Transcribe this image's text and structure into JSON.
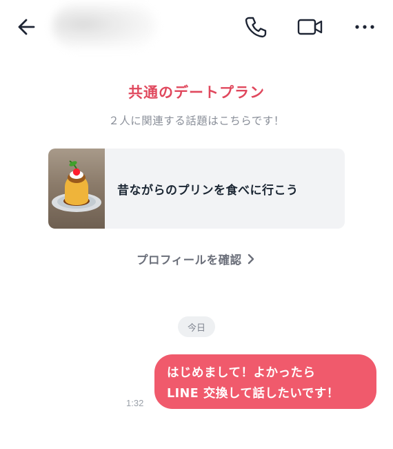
{
  "header": {
    "back_icon": "arrow-left-icon",
    "call_icon": "phone-icon",
    "video_icon": "video-camera-icon",
    "more_icon": "more-horizontal-icon"
  },
  "date_plan": {
    "title": "共通のデートプラン",
    "subtitle": "２人に関連する話題はこちらです！",
    "card": {
      "label": "昔ながらのプリンを食べに行こう",
      "image_icon": "pudding-photo"
    },
    "profile_link": "プロフィールを確認"
  },
  "chat": {
    "date_separator": "今日",
    "messages": [
      {
        "time": "1:32",
        "lines": [
          "はじめまして！よかったら",
          "LINE 交換して話したいです！"
        ]
      }
    ]
  },
  "colors": {
    "accent": "#e0485d",
    "bubble": "#f05a6c",
    "card_bg": "#f2f3f5",
    "icon": "#1d2433",
    "muted_text": "#8a8f99"
  }
}
